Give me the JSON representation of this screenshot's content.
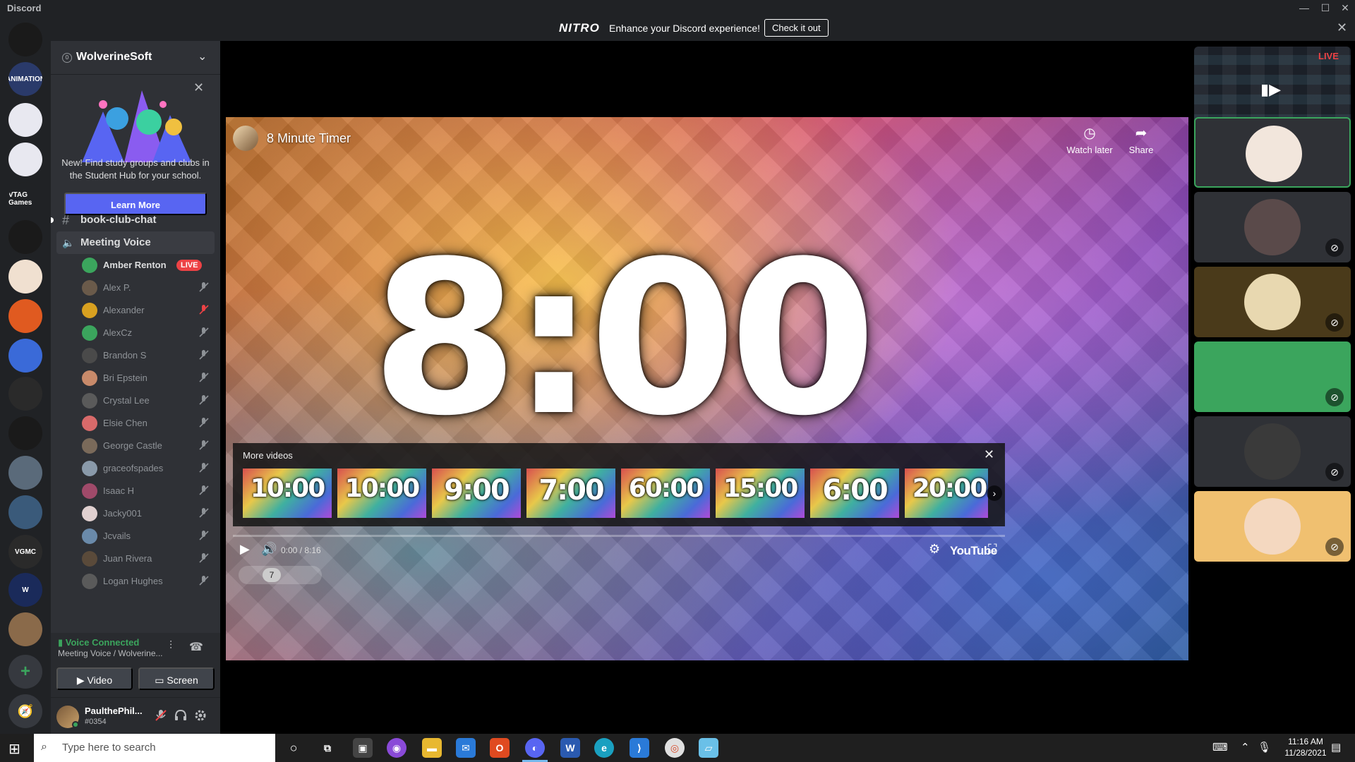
{
  "window": {
    "app_title": "Discord",
    "minimize": "—",
    "maximize": "☐",
    "close": "✕"
  },
  "nitro_banner": {
    "logo": "NITRO",
    "message": "Enhance your Discord experience!",
    "cta": "Check it out",
    "close": "✕"
  },
  "server_rail": {
    "add_server": "+",
    "explore": "🧭",
    "servers": [
      {
        "label": "",
        "color": "#1a1a1a"
      },
      {
        "label": "ANIMATION",
        "color": "#2a3a6a"
      },
      {
        "label": "",
        "color": "#e8e8f0"
      },
      {
        "label": "",
        "color": "#e8e8f0"
      },
      {
        "label": "VTAG Games",
        "color": "#202225"
      },
      {
        "label": "",
        "color": "#1a1a1a"
      },
      {
        "label": "",
        "color": "#f0e0d0"
      },
      {
        "label": "",
        "color": "#e05a20"
      },
      {
        "label": "",
        "color": "#3a6ad8"
      },
      {
        "label": "",
        "color": "#2a2a2a"
      },
      {
        "label": "",
        "color": "#1a1a1a"
      },
      {
        "label": "",
        "color": "#5a6a7a"
      },
      {
        "label": "",
        "color": "#3a5a7a"
      },
      {
        "label": "VGMC",
        "color": "#2a2a2a"
      },
      {
        "label": "W",
        "color": "#1a2a5a"
      },
      {
        "label": "",
        "color": "#8a6a4a"
      }
    ]
  },
  "guild": {
    "name": "WolverineSoft",
    "boost_count": "0",
    "chevron": "⌄"
  },
  "student_hub": {
    "close": "✕",
    "text": "New! Find study groups and clubs in the Student Hub for your school.",
    "button": "Learn More"
  },
  "channels": {
    "text_channel": {
      "icon": "#",
      "name": "book-club-chat"
    },
    "voice_channel": {
      "icon": "🔈",
      "name": "Meeting Voice"
    }
  },
  "voice_users": [
    {
      "name": "Amber Renton",
      "live": "LIVE",
      "avatar_color": "#3ba55d"
    },
    {
      "name": "Alex P.",
      "avatar_color": "#6a5a4a"
    },
    {
      "name": "Alexander",
      "avatar_color": "#d8a020"
    },
    {
      "name": "AlexCz",
      "avatar_color": "#3ba55d"
    },
    {
      "name": "Brandon S",
      "avatar_color": "#4a4a4a"
    },
    {
      "name": "Bri Epstein",
      "avatar_color": "#c88a6a"
    },
    {
      "name": "Crystal Lee",
      "avatar_color": "#5a5a5a"
    },
    {
      "name": "Elsie Chen",
      "avatar_color": "#d86a6a"
    },
    {
      "name": "George Castle",
      "avatar_color": "#7a6a5a"
    },
    {
      "name": "graceofspades",
      "avatar_color": "#8a9aaa"
    },
    {
      "name": "Isaac H",
      "avatar_color": "#a04a6a"
    },
    {
      "name": "Jacky001",
      "avatar_color": "#e0d0d0"
    },
    {
      "name": "Jcvails",
      "avatar_color": "#6a8aaa"
    },
    {
      "name": "Juan Rivera",
      "avatar_color": "#5a4a3a"
    },
    {
      "name": "Logan Hughes",
      "avatar_color": "#5a5a5a"
    }
  ],
  "voice_panel": {
    "status": "Voice Connected",
    "location": "Meeting Voice / Wolverine...",
    "video": "Video",
    "screen": "Screen"
  },
  "user_panel": {
    "name": "PaulthePhil...",
    "tag": "#0354"
  },
  "player": {
    "title": "8 Minute Timer",
    "watch_later": "Watch later",
    "share": "Share",
    "timer_display": "8:00",
    "more_videos_label": "More videos",
    "more_videos": [
      "10:00",
      "10:00",
      "9:00",
      "7:00",
      "60:00",
      "15:00",
      "6:00",
      "20:00"
    ],
    "time": "0:00 / 8:16",
    "progress": 0,
    "platform_logo": "YouTube",
    "page_number": "7"
  },
  "participants": {
    "stream_live": "LIVE",
    "tiles": [
      {
        "bg": "#2f3136",
        "avatar_color": "#f2e6dc",
        "speaking": true,
        "muted": false
      },
      {
        "bg": "#2f3136",
        "avatar_color": "#5a4a4a",
        "speaking": false,
        "muted": true
      },
      {
        "bg": "#4a3a1a",
        "avatar_color": "#e8d8b0",
        "speaking": false,
        "muted": true
      },
      {
        "bg": "#3ba55d",
        "avatar_color": "#3ba55d",
        "speaking": false,
        "muted": true
      },
      {
        "bg": "#2f3136",
        "avatar_color": "#3a3a3a",
        "speaking": false,
        "muted": true
      },
      {
        "bg": "#f0c070",
        "avatar_color": "#f4d8c0",
        "speaking": false,
        "muted": true
      }
    ]
  },
  "taskbar": {
    "search_placeholder": "Type here to search",
    "time": "11:16 AM",
    "date": "11/28/2021"
  }
}
